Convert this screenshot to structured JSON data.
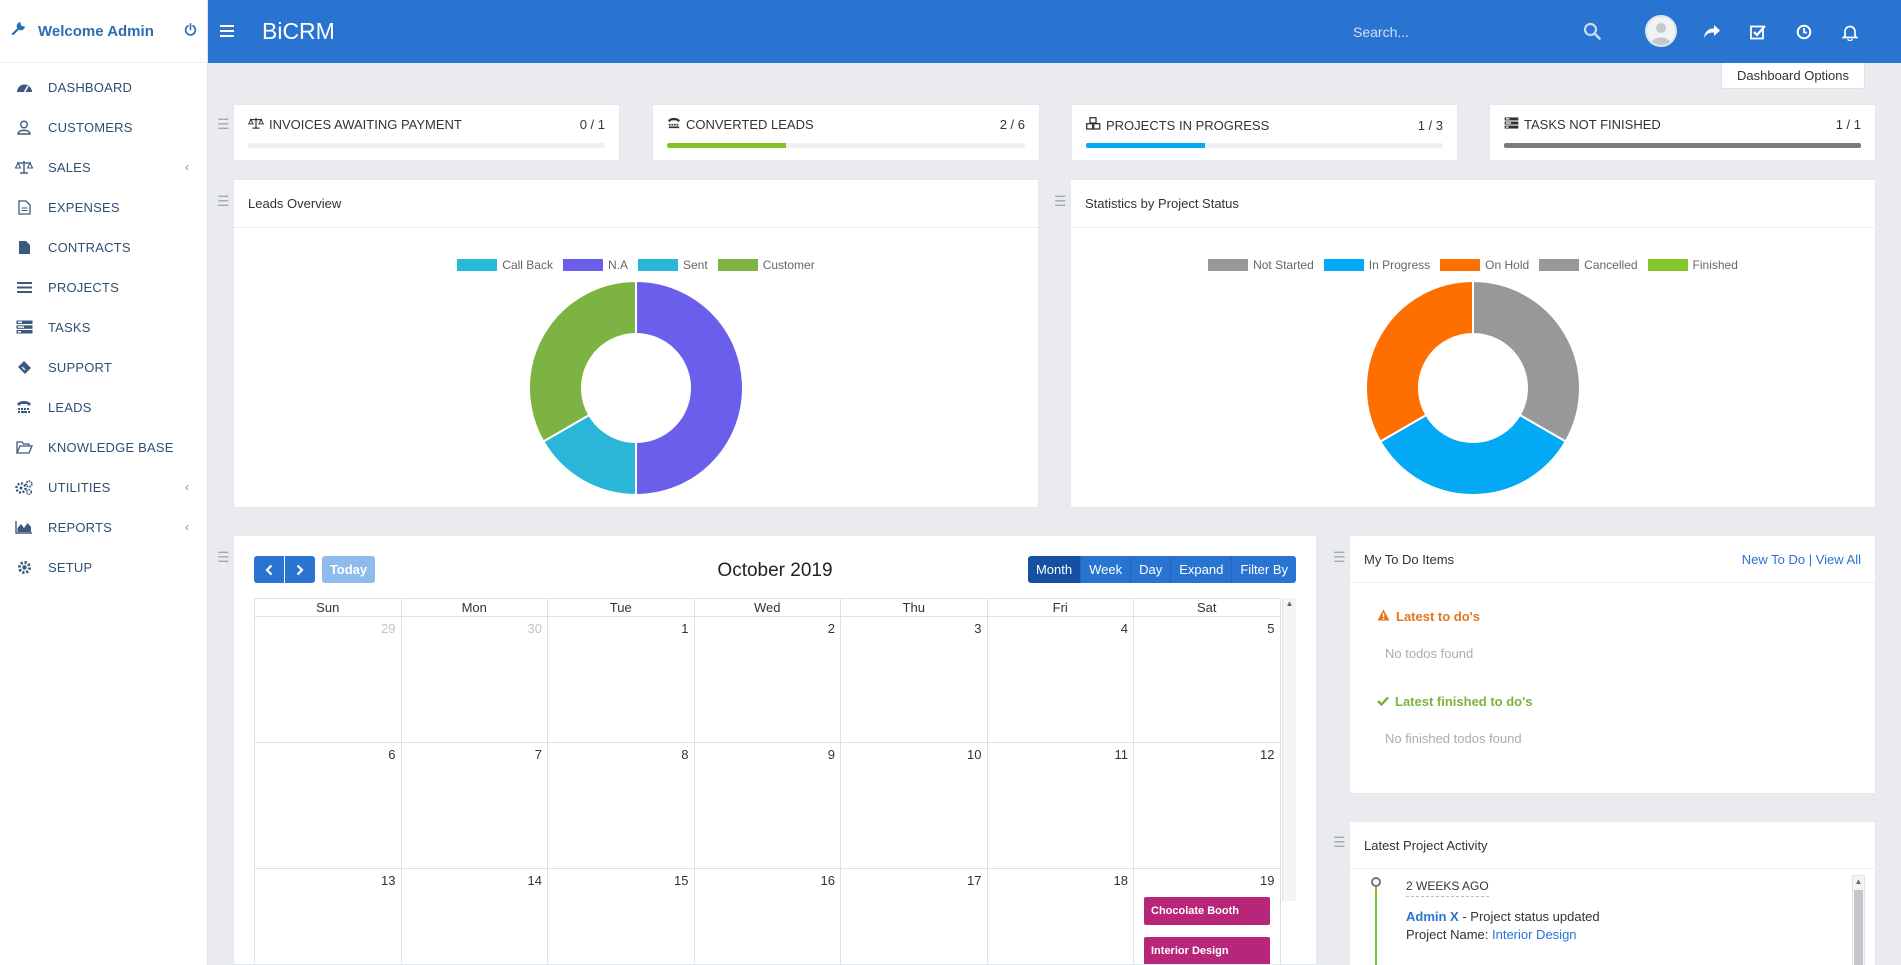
{
  "sidebar": {
    "welcome": "Welcome Admin",
    "items": [
      {
        "label": "DASHBOARD",
        "icon": "dashboard-icon"
      },
      {
        "label": "CUSTOMERS",
        "icon": "user-icon"
      },
      {
        "label": "SALES",
        "icon": "balance-scale-icon",
        "has_submenu": true
      },
      {
        "label": "EXPENSES",
        "icon": "file-text-icon"
      },
      {
        "label": "CONTRACTS",
        "icon": "file-icon"
      },
      {
        "label": "PROJECTS",
        "icon": "bars-icon"
      },
      {
        "label": "TASKS",
        "icon": "tasks-icon"
      },
      {
        "label": "SUPPORT",
        "icon": "ticket-icon"
      },
      {
        "label": "LEADS",
        "icon": "tty-icon"
      },
      {
        "label": "KNOWLEDGE BASE",
        "icon": "folder-open-icon"
      },
      {
        "label": "UTILITIES",
        "icon": "cogs-icon",
        "has_submenu": true
      },
      {
        "label": "REPORTS",
        "icon": "area-chart-icon",
        "has_submenu": true
      },
      {
        "label": "SETUP",
        "icon": "cog-icon"
      }
    ]
  },
  "header": {
    "brand": "BiCRM",
    "search_placeholder": "Search..."
  },
  "dashboard_options": "Dashboard Options",
  "stats": [
    {
      "title": "INVOICES AWAITING PAYMENT",
      "count": "0 / 1",
      "progress": 0,
      "color": "#2a74d1"
    },
    {
      "title": "CONVERTED LEADS",
      "count": "2 / 6",
      "progress": 0.333,
      "color": "#84c225"
    },
    {
      "title": "PROJECTS IN PROGRESS",
      "count": "1 / 3",
      "progress": 0.333,
      "color": "#03a9f4"
    },
    {
      "title": "TASKS NOT FINISHED",
      "count": "1 / 1",
      "progress": 1.0,
      "color": "#777b80"
    }
  ],
  "leads_overview": {
    "title": "Leads Overview"
  },
  "project_status": {
    "title": "Statistics by Project Status"
  },
  "chart_data": [
    {
      "type": "pie",
      "categories": [
        "Call Back",
        "N.A",
        "Sent",
        "Customer"
      ],
      "values": [
        0,
        3,
        1,
        2
      ],
      "colors": [
        "#28b8da",
        "#6a5eea",
        "#29b6d8",
        "#7cb342"
      ]
    },
    {
      "type": "pie",
      "categories": [
        "Not Started",
        "In Progress",
        "On Hold",
        "Cancelled",
        "Finished"
      ],
      "values": [
        1,
        1,
        1,
        0,
        0
      ],
      "colors": [
        "#989898",
        "#03a9f4",
        "#ff6f00",
        "#989898",
        "#84c529"
      ]
    }
  ],
  "calendar": {
    "title": "October 2019",
    "today": "Today",
    "views": [
      "Month",
      "Week",
      "Day",
      "Expand",
      "Filter By"
    ],
    "dows": [
      "Sun",
      "Mon",
      "Tue",
      "Wed",
      "Thu",
      "Fri",
      "Sat"
    ],
    "weeks": [
      [
        "29",
        "30",
        "1",
        "2",
        "3",
        "4",
        "5"
      ],
      [
        "6",
        "7",
        "8",
        "9",
        "10",
        "11",
        "12"
      ],
      [
        "13",
        "14",
        "15",
        "16",
        "17",
        "18",
        "19"
      ]
    ],
    "events": [
      "Chocolate Booth",
      "Interior Design"
    ]
  },
  "todo": {
    "title": "My To Do Items",
    "new_link": "New To Do",
    "view_all": "| View All",
    "latest_label": "Latest to do's",
    "latest_empty": "No todos found",
    "finished_label": "Latest finished to do's",
    "finished_empty": "No finished todos found"
  },
  "activity": {
    "title": "Latest Project Activity",
    "when": "2 WEEKS AGO",
    "user": "Admin X",
    "description": " - Project status updated",
    "project_label": "Project Name: ",
    "project_name": "Interior Design"
  }
}
